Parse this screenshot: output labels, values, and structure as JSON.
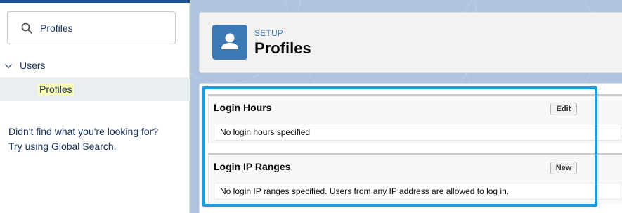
{
  "search": {
    "value": "Profiles",
    "icon": "search-icon"
  },
  "sidebar": {
    "tree": {
      "parent_label": "Users",
      "child_label": "Profiles"
    },
    "not_found_line1": "Didn't find what you're looking for?",
    "not_found_line2": "Try using Global Search."
  },
  "header": {
    "eyebrow": "SETUP",
    "title": "Profiles",
    "icon": "user-icon"
  },
  "sections": {
    "login_hours": {
      "title": "Login Hours",
      "button_label": "Edit",
      "body_text": "No login hours specified"
    },
    "login_ip_ranges": {
      "title": "Login IP Ranges",
      "button_label": "New",
      "body_text": "No login IP ranges specified. Users from any IP address are allowed to log in."
    }
  },
  "colors": {
    "accent": "#3c79b4",
    "highlight_border": "#1f9ce0",
    "main_background": "#b0c4df"
  }
}
